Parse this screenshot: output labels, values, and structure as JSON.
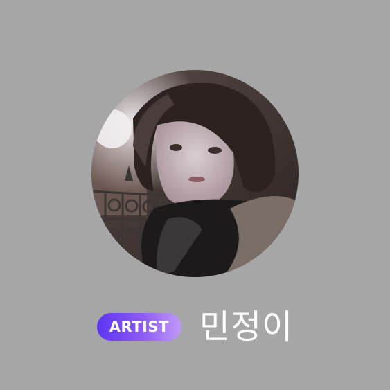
{
  "profile": {
    "photo_icon": "profile-photo",
    "badge_label": "ARTIST",
    "display_name": "민정이"
  },
  "colors": {
    "background": "#a6a6a6",
    "badge_gradient_start": "#5b35f2",
    "badge_gradient_end": "#c29af6",
    "text": "#ffffff"
  }
}
